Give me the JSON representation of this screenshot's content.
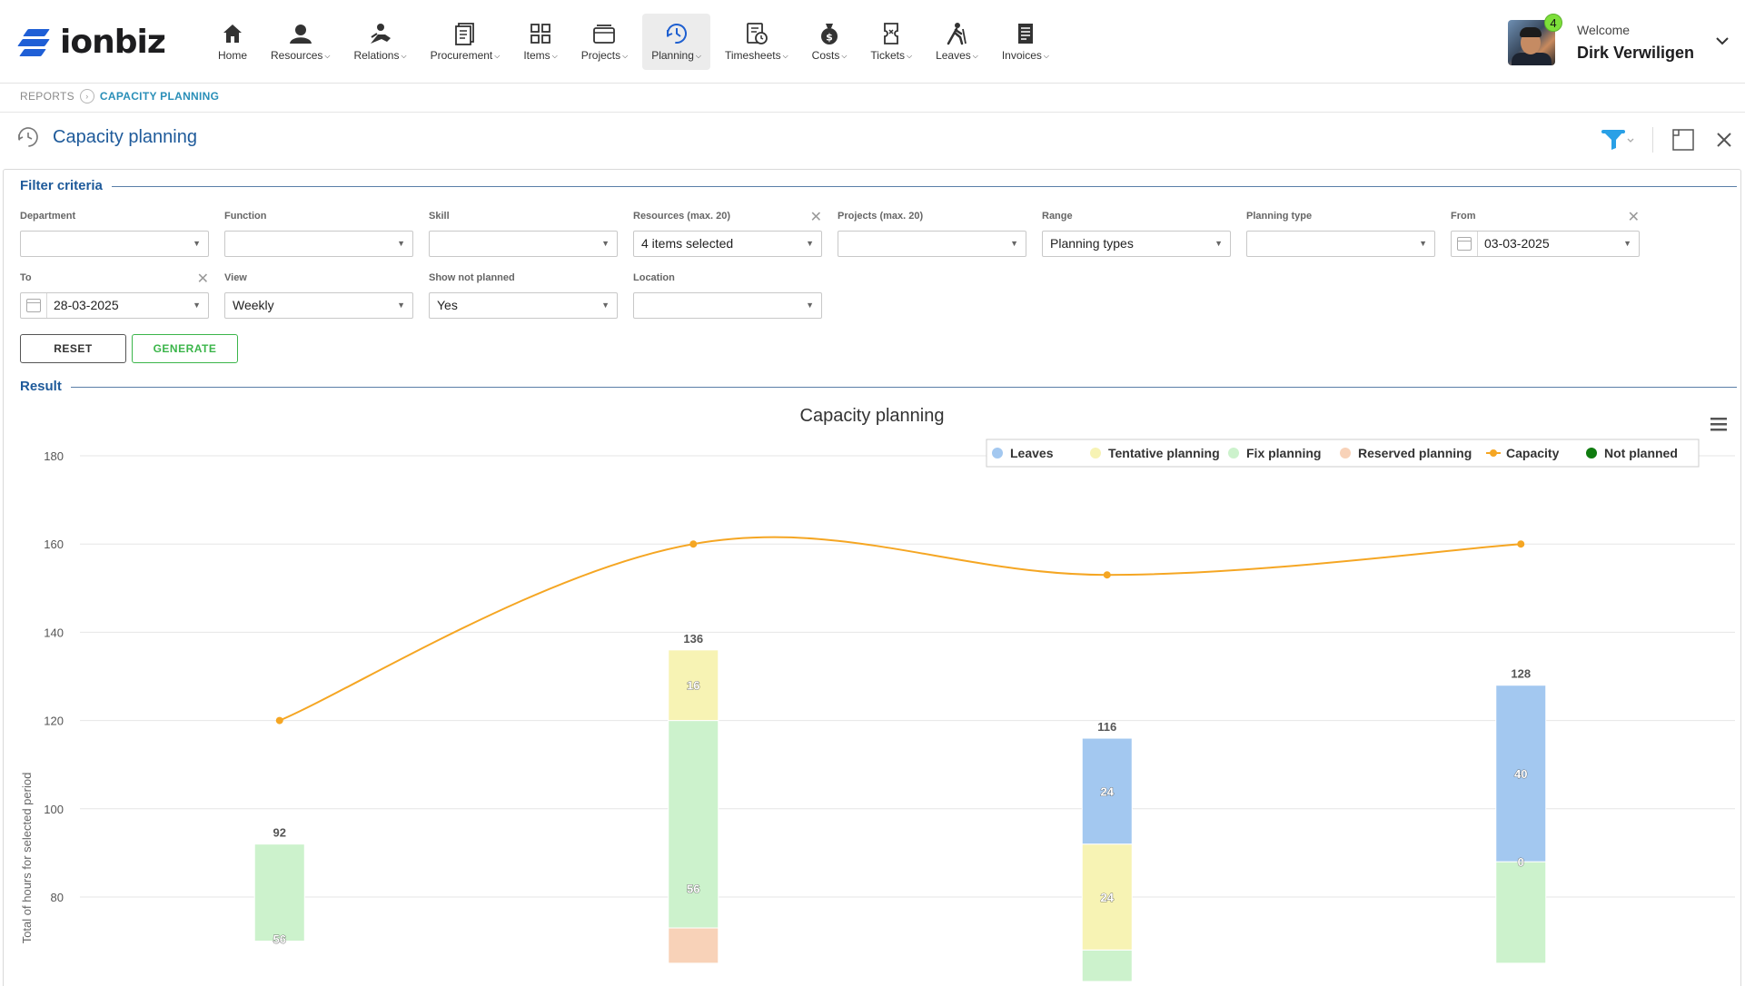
{
  "brand": {
    "logo_text_a": "ion",
    "logo_text_b": "biz"
  },
  "nav": [
    {
      "label": "Home",
      "icon": "home-icon",
      "dropdown": false
    },
    {
      "label": "Resources",
      "icon": "resources-icon",
      "dropdown": true
    },
    {
      "label": "Relations",
      "icon": "relations-icon",
      "dropdown": true
    },
    {
      "label": "Procurement",
      "icon": "procurement-icon",
      "dropdown": true
    },
    {
      "label": "Items",
      "icon": "items-icon",
      "dropdown": true
    },
    {
      "label": "Projects",
      "icon": "projects-icon",
      "dropdown": true
    },
    {
      "label": "Planning",
      "icon": "planning-icon",
      "dropdown": true,
      "active": true
    },
    {
      "label": "Timesheets",
      "icon": "timesheets-icon",
      "dropdown": true
    },
    {
      "label": "Costs",
      "icon": "costs-icon",
      "dropdown": true
    },
    {
      "label": "Tickets",
      "icon": "tickets-icon",
      "dropdown": true
    },
    {
      "label": "Leaves",
      "icon": "leaves-icon",
      "dropdown": true
    },
    {
      "label": "Invoices",
      "icon": "invoices-icon",
      "dropdown": true
    }
  ],
  "user": {
    "welcome": "Welcome",
    "name": "Dirk Verwiligen",
    "notifications": "4"
  },
  "breadcrumb": {
    "root": "REPORTS",
    "current": "CAPACITY PLANNING"
  },
  "page": {
    "title": "Capacity planning"
  },
  "filter": {
    "title": "Filter criteria",
    "fields": {
      "department": {
        "label": "Department",
        "value": ""
      },
      "function": {
        "label": "Function",
        "value": ""
      },
      "skill": {
        "label": "Skill",
        "value": ""
      },
      "resources": {
        "label": "Resources (max. 20)",
        "value": "4 items selected"
      },
      "projects": {
        "label": "Projects (max. 20)",
        "value": ""
      },
      "range": {
        "label": "Range",
        "value": "Planning types"
      },
      "planning_type": {
        "label": "Planning type",
        "value": ""
      },
      "from": {
        "label": "From",
        "value": "03-03-2025"
      },
      "to": {
        "label": "To",
        "value": "28-03-2025"
      },
      "view": {
        "label": "View",
        "value": "Weekly"
      },
      "show_not_planned": {
        "label": "Show not planned",
        "value": "Yes"
      },
      "location": {
        "label": "Location",
        "value": ""
      }
    },
    "reset_label": "RESET",
    "generate_label": "GENERATE"
  },
  "result": {
    "title": "Result"
  },
  "colors": {
    "leaves": "#a3c8f0",
    "tentative": "#f7f3b4",
    "fix": "#ccf2cc",
    "reserved": "#f8d2b8",
    "capacity": "#f5a623",
    "not_planned": "#107c10"
  },
  "chart_data": {
    "type": "bar",
    "title": "Capacity planning",
    "ylabel": "Total of hours for selected period",
    "ylim": [
      70,
      185
    ],
    "yticks": [
      80,
      100,
      120,
      140,
      160,
      180
    ],
    "categories": [
      "",
      "",
      "",
      ""
    ],
    "legend_position": "top-right",
    "series": [
      {
        "name": "Leaves",
        "key": "leaves",
        "kind": "bar",
        "values": [
          0,
          0,
          24,
          40
        ]
      },
      {
        "name": "Tentative planning",
        "key": "tentative",
        "kind": "bar",
        "values": [
          0,
          16,
          24,
          0
        ]
      },
      {
        "name": "Fix planning",
        "key": "fix",
        "kind": "bar",
        "values": [
          56,
          56,
          null,
          null
        ]
      },
      {
        "name": "Reserved planning",
        "key": "reserved",
        "kind": "bar",
        "values": [
          null,
          null,
          null,
          null
        ]
      },
      {
        "name": "Capacity",
        "key": "capacity",
        "kind": "line",
        "values": [
          120,
          160,
          153,
          160
        ]
      },
      {
        "name": "Not planned",
        "key": "not_planned",
        "kind": "point",
        "values": [
          null,
          null,
          null,
          null
        ]
      }
    ],
    "visible_segments": [
      [
        {
          "key": "fix",
          "from": 70,
          "to": 92,
          "label": "56"
        }
      ],
      [
        {
          "key": "reserved",
          "from": 70,
          "to": 73,
          "label": ""
        },
        {
          "key": "fix",
          "from": 73,
          "to": 120,
          "label": "56"
        },
        {
          "key": "tentative",
          "from": 120,
          "to": 136,
          "label": "16"
        }
      ],
      [
        {
          "key": "fix",
          "from": 70,
          "to": 68,
          "label": ""
        },
        {
          "key": "fix",
          "from": 70,
          "to": 68,
          "label": ""
        },
        {
          "key": "fix",
          "from": 70,
          "to": 68,
          "label": ""
        },
        {
          "key": "fix",
          "from": 70,
          "to": 68,
          "label": ""
        },
        {
          "key": "tentative",
          "from": 68,
          "to": 92,
          "label": "24"
        },
        {
          "key": "leaves",
          "from": 92,
          "to": 116,
          "label": "24"
        }
      ],
      [
        {
          "key": "fix",
          "from": 70,
          "to": 88,
          "label": ""
        },
        {
          "key": "leaves",
          "from": 88,
          "to": 128,
          "label": "40"
        }
      ]
    ],
    "bar_labels": [
      "92",
      "136",
      "116",
      "128"
    ],
    "inner_zero_label": "0"
  }
}
